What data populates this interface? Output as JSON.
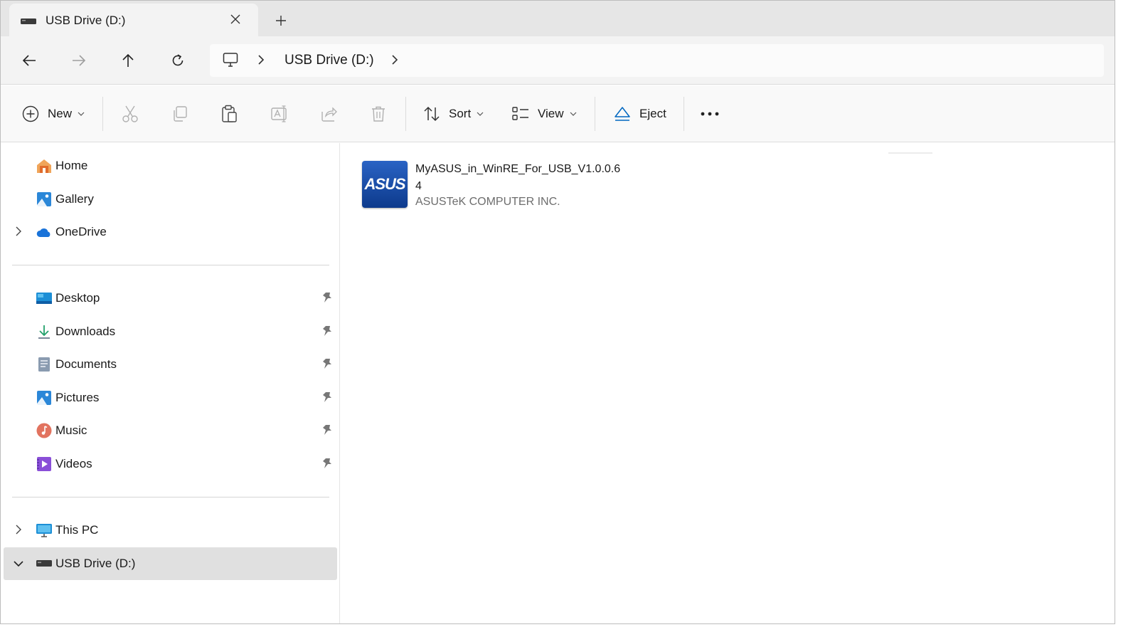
{
  "tab": {
    "title": "USB Drive (D:)",
    "close_icon": "close-icon",
    "new_tab_icon": "plus-icon"
  },
  "nav": {
    "back_icon": "arrow-left-icon",
    "forward_icon": "arrow-right-icon",
    "up_icon": "arrow-up-icon",
    "refresh_icon": "refresh-icon",
    "breadcrumb": [
      "USB Drive (D:)"
    ]
  },
  "toolbar": {
    "new_label": "New",
    "sort_label": "Sort",
    "view_label": "View",
    "eject_label": "Eject",
    "icons": [
      "cut-icon",
      "copy-icon",
      "paste-icon",
      "rename-icon",
      "share-icon",
      "delete-icon",
      "more-icon"
    ]
  },
  "sidebar": {
    "top": [
      {
        "label": "Home",
        "icon": "home-icon"
      },
      {
        "label": "Gallery",
        "icon": "gallery-icon"
      },
      {
        "label": "OneDrive",
        "icon": "onedrive-icon"
      }
    ],
    "pinned": [
      {
        "label": "Desktop",
        "icon": "desktop-icon"
      },
      {
        "label": "Downloads",
        "icon": "downloads-icon"
      },
      {
        "label": "Documents",
        "icon": "documents-icon"
      },
      {
        "label": "Pictures",
        "icon": "pictures-icon"
      },
      {
        "label": "Music",
        "icon": "music-icon"
      },
      {
        "label": "Videos",
        "icon": "videos-icon"
      }
    ],
    "bottom": [
      {
        "label": "This PC",
        "icon": "this-pc-icon"
      },
      {
        "label": "USB Drive (D:)",
        "icon": "usb-drive-icon",
        "selected": true
      }
    ]
  },
  "files": [
    {
      "name": "MyASUS_in_WinRE_For_USB_V1.0.0.64",
      "company": "ASUSTeK COMPUTER INC.",
      "logo_text": "ASUS"
    }
  ],
  "colors": {
    "accent": "#0067c0",
    "selected_bg": "#e0e0e0",
    "file_thumb": "#1a4fa8"
  }
}
